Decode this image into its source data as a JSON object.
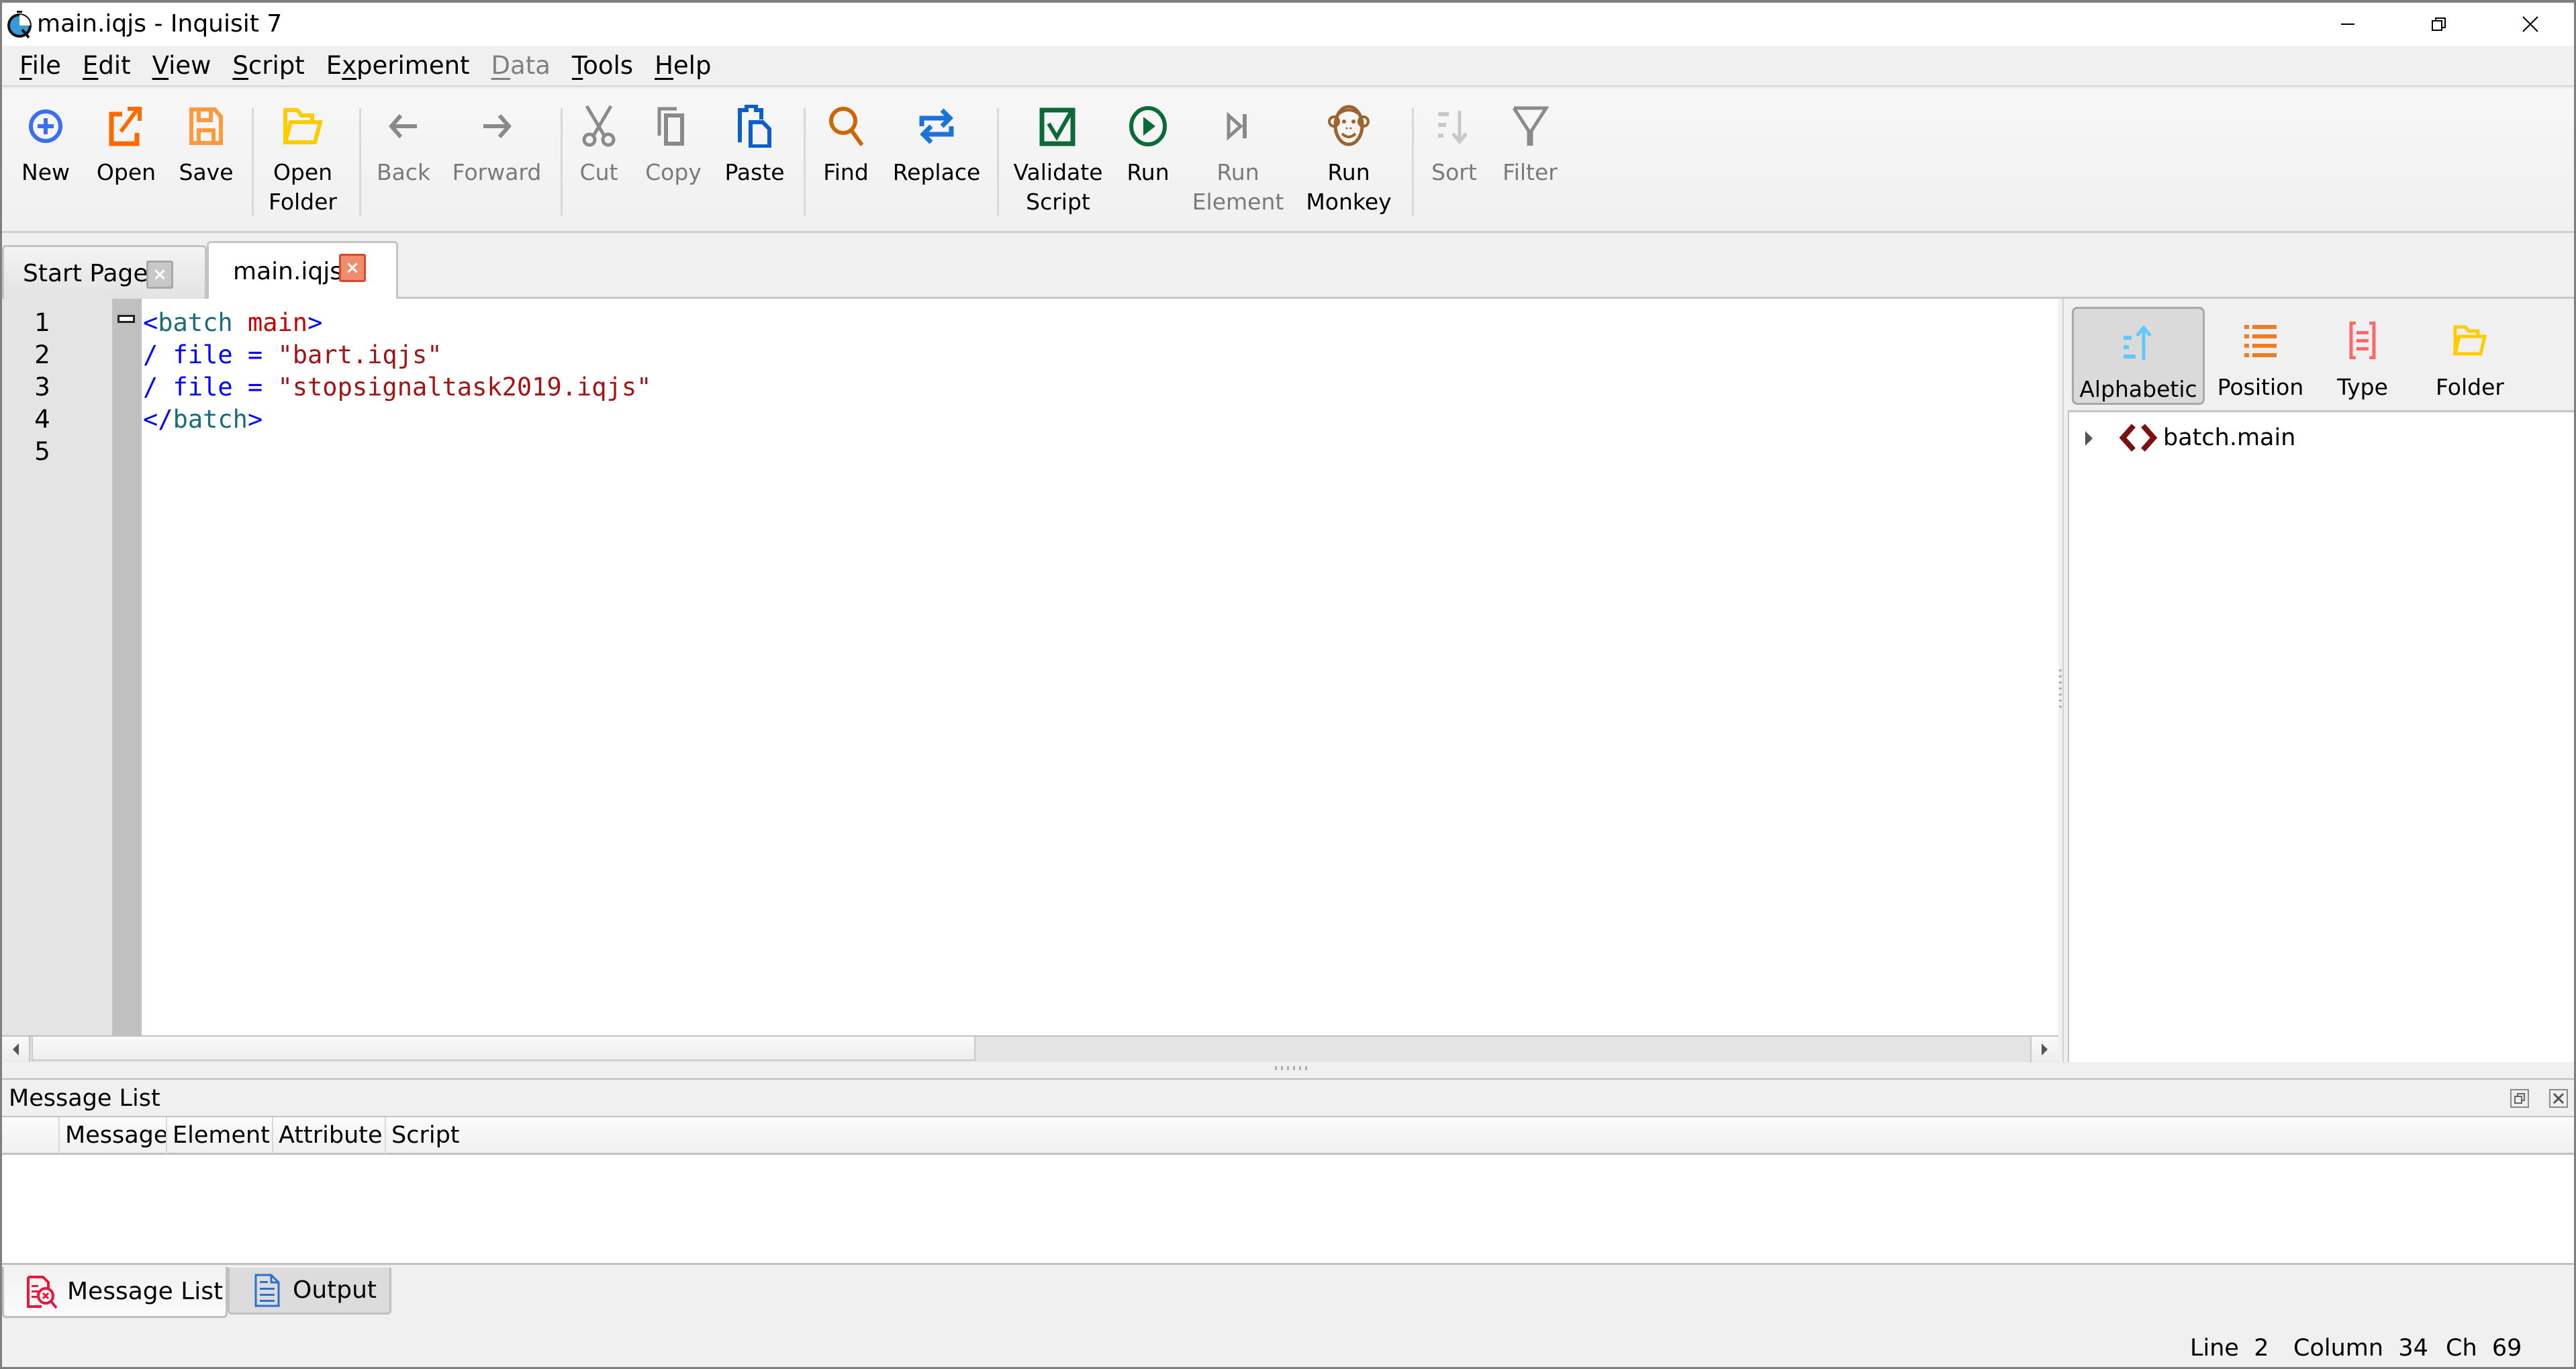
{
  "window": {
    "title": "main.iqjs - Inquisit 7",
    "controls": [
      "minimize",
      "restore",
      "close"
    ]
  },
  "menubar": {
    "items": [
      {
        "label": "File",
        "mnemonic": "F",
        "rest": "ile",
        "enabled": true
      },
      {
        "label": "Edit",
        "mnemonic": "E",
        "rest": "dit",
        "enabled": true
      },
      {
        "label": "View",
        "mnemonic": "V",
        "rest": "iew",
        "enabled": true
      },
      {
        "label": "Script",
        "mnemonic": "S",
        "rest": "cript",
        "enabled": true
      },
      {
        "label": "Experiment",
        "pre": "E",
        "mnemonic": "x",
        "rest": "periment",
        "enabled": true
      },
      {
        "label": "Data",
        "mnemonic": "D",
        "rest": "ata",
        "enabled": false
      },
      {
        "label": "Tools",
        "mnemonic": "T",
        "rest": "ools",
        "enabled": true
      },
      {
        "label": "Help",
        "mnemonic": "H",
        "rest": "elp",
        "enabled": true
      }
    ]
  },
  "toolbar": {
    "new": {
      "label": "New",
      "icon": "plus-circle-icon",
      "enabled": true
    },
    "open": {
      "label": "Open",
      "icon": "open-external-icon",
      "enabled": true
    },
    "save": {
      "label": "Save",
      "icon": "floppy-disk-icon",
      "enabled": true
    },
    "open_folder": {
      "label": "Open\nFolder",
      "icon": "folder-open-icon",
      "enabled": true
    },
    "back": {
      "label": "Back",
      "icon": "arrow-left-icon",
      "enabled": false
    },
    "forward": {
      "label": "Forward",
      "icon": "arrow-right-icon",
      "enabled": false
    },
    "cut": {
      "label": "Cut",
      "icon": "scissors-icon",
      "enabled": false
    },
    "copy": {
      "label": "Copy",
      "icon": "copy-icon",
      "enabled": false
    },
    "paste": {
      "label": "Paste",
      "icon": "paste-icon",
      "enabled": true
    },
    "find": {
      "label": "Find",
      "icon": "magnifier-icon",
      "enabled": true
    },
    "replace": {
      "label": "Replace",
      "icon": "replace-arrows-icon",
      "enabled": true
    },
    "validate": {
      "label": "Validate\nScript",
      "icon": "checkbox-checked-icon",
      "enabled": true
    },
    "run": {
      "label": "Run",
      "icon": "play-circle-icon",
      "enabled": true
    },
    "run_element": {
      "label": "Run\nElement",
      "icon": "step-forward-icon",
      "enabled": false
    },
    "run_monkey": {
      "label": "Run\nMonkey",
      "icon": "monkey-icon",
      "enabled": true
    },
    "sort": {
      "label": "Sort",
      "icon": "sort-down-icon",
      "enabled": false
    },
    "filter": {
      "label": "Filter",
      "icon": "filter-funnel-icon",
      "enabled": false
    }
  },
  "colors": {
    "new": "#3b6ef5",
    "open": "#ff6a00",
    "save": "#ff9a3c",
    "folder": "#ffcc00",
    "disabled": "#8a8a8a",
    "paste": "#0a5fcc",
    "find": "#cc6600",
    "replace": "#1a73d9",
    "validate": "#0b6b35",
    "run": "#0b6b35",
    "monkey": "#a0622d",
    "alpha_sort": "#5fc8ff",
    "position_sort": "#f07b23",
    "type_sort": "#ff6868",
    "tree_icon": "#7a1010",
    "message_list_icon": "#e8173c",
    "output_icon": "#2d6fcc"
  },
  "tabs": [
    {
      "label": "Start Page",
      "active": false
    },
    {
      "label": "main.iqjs",
      "active": true
    }
  ],
  "editor": {
    "line_numbers": [
      "1",
      "2",
      "3",
      "4",
      "5"
    ],
    "lines": [
      [
        {
          "t": "<",
          "c": "punct"
        },
        {
          "t": "batch",
          "c": "tag"
        },
        {
          "t": " ",
          "c": "punct"
        },
        {
          "t": "main",
          "c": "attr"
        },
        {
          "t": ">",
          "c": "punct"
        }
      ],
      [
        {
          "t": "/ file = ",
          "c": "key"
        },
        {
          "t": "\"bart.iqjs\"",
          "c": "str"
        }
      ],
      [
        {
          "t": "/ file = ",
          "c": "key"
        },
        {
          "t": "\"stopsignaltask2019.iqjs\"",
          "c": "str"
        }
      ],
      [
        {
          "t": "</",
          "c": "punct"
        },
        {
          "t": "batch",
          "c": "tag"
        },
        {
          "t": ">",
          "c": "punct"
        }
      ],
      []
    ]
  },
  "right_panel": {
    "sort_buttons": {
      "alphabetic": {
        "label": "Alphabetic",
        "active": true
      },
      "position": {
        "label": "Position",
        "active": false
      },
      "type": {
        "label": "Type",
        "active": false
      },
      "folder": {
        "label": "Folder",
        "active": false
      }
    },
    "tree": [
      {
        "label": "batch.main",
        "expanded": false
      }
    ]
  },
  "message_panel": {
    "title": "Message List",
    "columns": [
      "",
      "Message",
      "Element",
      "Attribute",
      "Script"
    ],
    "rows": []
  },
  "bottom_tabs": [
    {
      "label": "Message List",
      "active": true
    },
    {
      "label": "Output",
      "active": false
    }
  ],
  "status": {
    "line_label": "Line",
    "line": "2",
    "column_label": "Column",
    "column": "34",
    "ch_label": "Ch",
    "ch": "69"
  }
}
